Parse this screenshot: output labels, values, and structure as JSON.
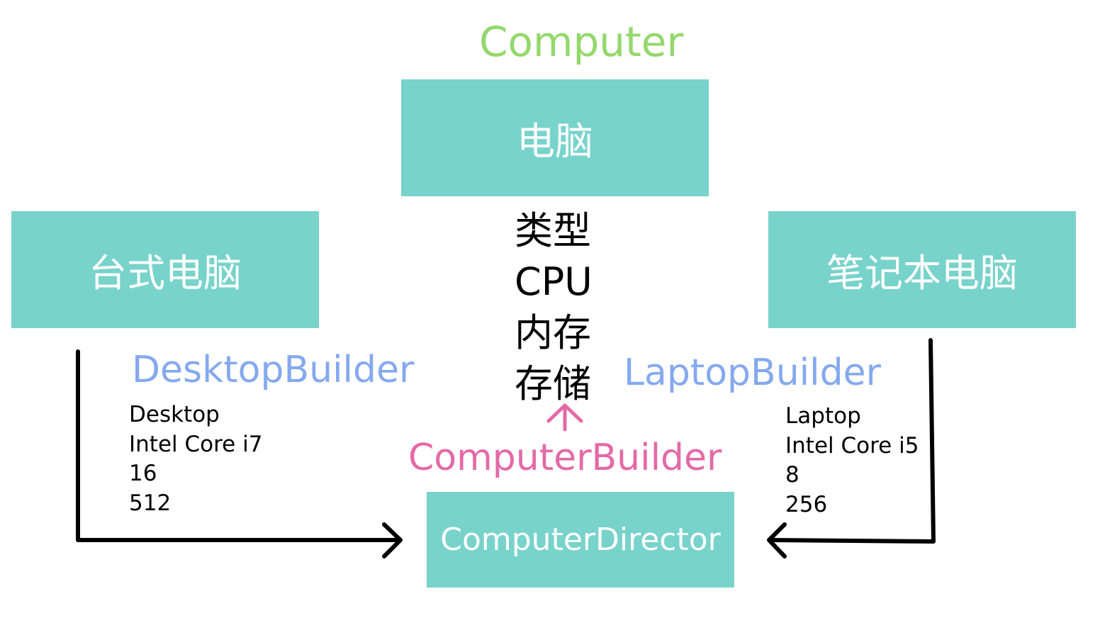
{
  "colors": {
    "box_fill": "#78d3cb",
    "box_text": "#ffffff",
    "computer_title": "#94d86c",
    "builder_label": "#85a9ef",
    "computer_builder_label": "#e46aa6",
    "arrow": "#000000",
    "up_arrow": "#e46aa6"
  },
  "computer_title": "Computer",
  "computer_box": {
    "label": "电脑"
  },
  "fields": [
    "类型",
    "CPU",
    "内存",
    "存储"
  ],
  "desktop_box": {
    "label": "台式电脑"
  },
  "laptop_box": {
    "label": "笔记本电脑"
  },
  "desktop_builder": {
    "name": "DesktopBuilder",
    "values": [
      "Desktop",
      "Intel Core i7",
      "16",
      "512"
    ]
  },
  "laptop_builder": {
    "name": "LaptopBuilder",
    "values": [
      "Laptop",
      "Intel Core i5",
      "8",
      "256"
    ]
  },
  "computer_builder": {
    "name": "ComputerBuilder"
  },
  "director_box": {
    "label": "ComputerDirector"
  },
  "icons": {
    "up_arrow": "arrow-up-icon",
    "desktop_arrow": "elbow-arrow-right",
    "laptop_arrow": "elbow-arrow-left"
  }
}
